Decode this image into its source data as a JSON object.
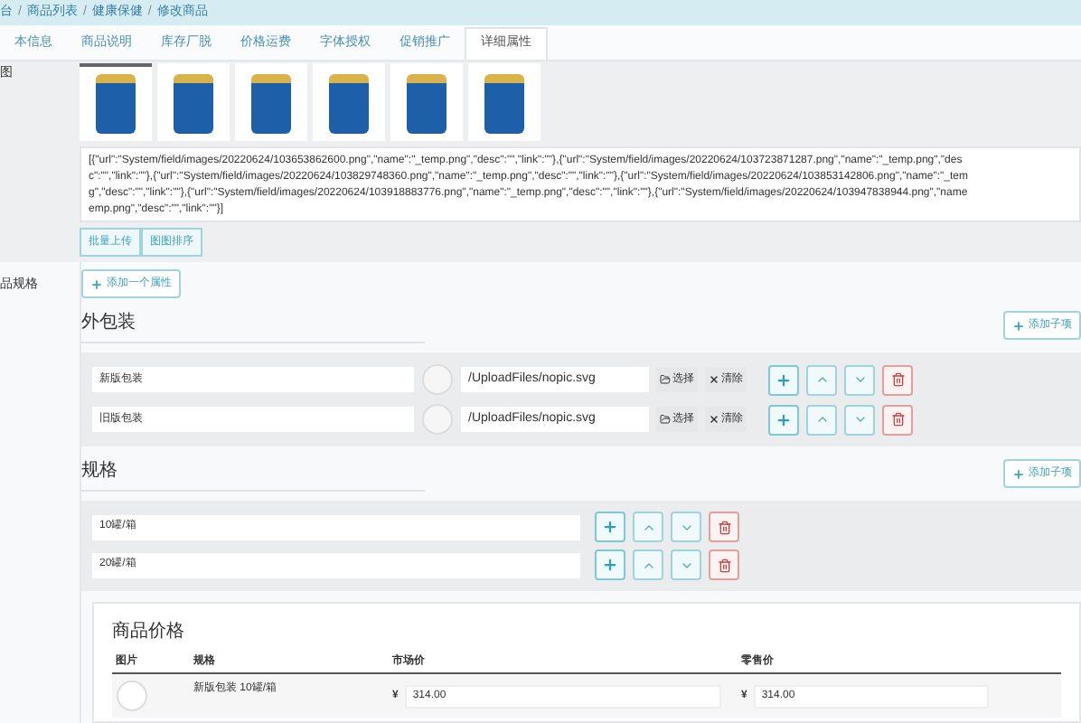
{
  "breadcrumb": [
    {
      "kind": "link",
      "text": "台"
    },
    {
      "kind": "separator",
      "text": "/"
    },
    {
      "kind": "link",
      "text": "商品列表"
    },
    {
      "kind": "separator",
      "text": "/"
    },
    {
      "kind": "link",
      "text": "健康保健"
    },
    {
      "kind": "separator",
      "text": "/"
    },
    {
      "kind": "link",
      "text": "修改商品"
    }
  ],
  "tabs": [
    {
      "label": "本信息",
      "selected": false
    },
    {
      "label": "商品说明",
      "selected": false
    },
    {
      "label": "库存厂脱",
      "selected": false
    },
    {
      "label": "价格运费",
      "selected": false
    },
    {
      "label": "字体授权",
      "selected": false
    },
    {
      "label": "促销推广",
      "selected": false
    },
    {
      "label": "详细属性",
      "selected": true
    }
  ],
  "images_label": "图",
  "images": [
    {
      "selected": true
    },
    {
      "selected": false
    },
    {
      "selected": false
    },
    {
      "selected": false
    },
    {
      "selected": false
    },
    {
      "selected": false
    }
  ],
  "images_json": [
    "[{\"url\":\"System/field/images/20220624/103653862600.png\",\"name\":\"_temp.png\",\"desc\":\"\",\"link\":\"\"},{\"url\":\"System/field/images/20220624/103723871287.png\",\"name\":\"_temp.png\",\"des",
    "c\":\"\",\"link\":\"\"},{\"url\":\"System/field/images/20220624/103829748360.png\",\"name\":\"_temp.png\",\"desc\":\"\",\"link\":\"\"},{\"url\":\"System/field/images/20220624/103853142806.png\",\"name\":\"_tem",
    "g\",\"desc\":\"\",\"link\":\"\"},{\"url\":\"System/field/images/20220624/103918883776.png\",\"name\":\"_temp.png\",\"desc\":\"\",\"link\":\"\"},{\"url\":\"System/field/images/20220624/103947838944.png\",\"name",
    "emp.png\",\"desc\":\"\",\"link\":\"\"}]"
  ],
  "image_buttons": [
    "批量上传",
    "图图排序"
  ],
  "spec_label": "品规格",
  "add_attribute": "添加一个属性",
  "groups": [
    {
      "title": "外包装",
      "add_child": "添加子项",
      "items": [
        {
          "kind": "image",
          "value": "新版包装",
          "path": "/UploadFiles/nopic.svg",
          "choose": "选择",
          "clear": "清除"
        },
        {
          "kind": "image",
          "value": "旧版包装",
          "path": "/UploadFiles/nopic.svg",
          "choose": "选择",
          "clear": "清除"
        }
      ]
    },
    {
      "title": "规格",
      "add_child": "添加子项",
      "items": [
        {
          "kind": "text",
          "value": "10罐/箱"
        },
        {
          "kind": "text",
          "value": "20罐/箱"
        }
      ]
    }
  ],
  "price": {
    "title": "商品价格",
    "columns": [
      "图片",
      "规格",
      "市场价",
      "零售价"
    ],
    "rows": [
      {
        "spec": "新版包装 10罐/箱",
        "market_currency": "¥",
        "market": "314.00",
        "retail_currency": "¥",
        "retail": "314.00"
      }
    ]
  }
}
